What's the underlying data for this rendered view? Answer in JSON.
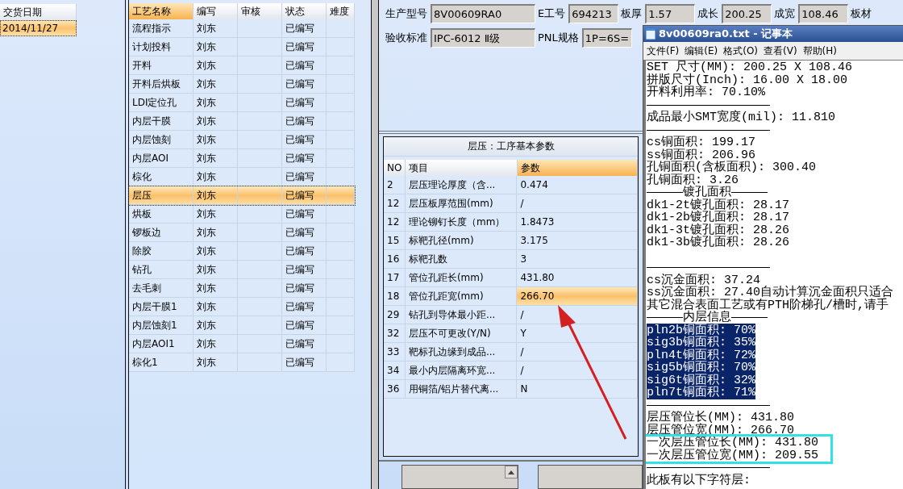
{
  "delivery_table": {
    "columns": [
      {
        "label": "交货日期",
        "selected": false
      }
    ],
    "rows": [
      {
        "date": "2014/11/27",
        "selected": true
      }
    ]
  },
  "process_table": {
    "columns": [
      {
        "label": "工艺名称",
        "selected": true
      },
      {
        "label": "编写",
        "selected": false
      },
      {
        "label": "审核",
        "selected": false
      },
      {
        "label": "状态",
        "selected": false
      },
      {
        "label": "难度",
        "selected": false
      }
    ],
    "rows": [
      {
        "name": "流程指示",
        "author": "刘东",
        "status": "已编写",
        "selected": false
      },
      {
        "name": "计划投料",
        "author": "刘东",
        "status": "已编写",
        "selected": false
      },
      {
        "name": "开料",
        "author": "刘东",
        "status": "已编写",
        "selected": false
      },
      {
        "name": "开料后烘板",
        "author": "刘东",
        "status": "已编写",
        "selected": false
      },
      {
        "name": "LDI定位孔",
        "author": "刘东",
        "status": "已编写",
        "selected": false
      },
      {
        "name": "内层干膜",
        "author": "刘东",
        "status": "已编写",
        "selected": false
      },
      {
        "name": "内层蚀刻",
        "author": "刘东",
        "status": "已编写",
        "selected": false
      },
      {
        "name": "内层AOI",
        "author": "刘东",
        "status": "已编写",
        "selected": false
      },
      {
        "name": "棕化",
        "author": "刘东",
        "status": "已编写",
        "selected": false
      },
      {
        "name": "层压",
        "author": "刘东",
        "status": "已编写",
        "selected": true
      },
      {
        "name": "烘板",
        "author": "刘东",
        "status": "已编写",
        "selected": false
      },
      {
        "name": "锣板边",
        "author": "刘东",
        "status": "已编写",
        "selected": false
      },
      {
        "name": "除胶",
        "author": "刘东",
        "status": "已编写",
        "selected": false
      },
      {
        "name": "钻孔",
        "author": "刘东",
        "status": "已编写",
        "selected": false
      },
      {
        "name": "去毛刺",
        "author": "刘东",
        "status": "已编写",
        "selected": false
      },
      {
        "name": "内层干膜1",
        "author": "刘东",
        "status": "已编写",
        "selected": false
      },
      {
        "name": "内层蚀刻1",
        "author": "刘东",
        "status": "已编写",
        "selected": false
      },
      {
        "name": "内层AOI1",
        "author": "刘东",
        "status": "已编写",
        "selected": false
      },
      {
        "name": "棕化1",
        "author": "刘东",
        "status": "已编写",
        "selected": false
      }
    ]
  },
  "form": {
    "rows": [
      [
        {
          "label": "生产型号",
          "value": "8V00609RA0"
        },
        {
          "label": "E工号",
          "value": "694213"
        },
        {
          "label": "板厚",
          "value": "1.57"
        },
        {
          "label": "成长",
          "value": "200.25"
        },
        {
          "label": "成宽",
          "value": "108.46"
        },
        {
          "label": "板材"
        }
      ],
      [
        {
          "label": "验收标准",
          "value": "IPC-6012 Ⅱ级"
        },
        {
          "label": "PNL规格",
          "value": "1P=6S="
        }
      ]
    ]
  },
  "params_table": {
    "title": "层压：工序基本参数",
    "columns": [
      {
        "label": "NO",
        "selected": false
      },
      {
        "label": "项目",
        "selected": false
      },
      {
        "label": "参数",
        "selected": true
      }
    ],
    "rows": [
      {
        "no": "2",
        "item": "层压理论厚度（含...",
        "value": "0.474",
        "selected": false
      },
      {
        "no": "12",
        "item": "层压板厚范围(mm)",
        "value": "/",
        "selected": false
      },
      {
        "no": "12",
        "item": "理论铆钉长度（mm）",
        "value": "1.8473",
        "selected": false
      },
      {
        "no": "15",
        "item": "标靶孔径(mm)",
        "value": "3.175",
        "selected": false
      },
      {
        "no": "16",
        "item": "标靶孔数",
        "value": "3",
        "selected": false
      },
      {
        "no": "17",
        "item": "管位孔距长(mm)",
        "value": "431.80",
        "selected": false
      },
      {
        "no": "18",
        "item": "管位孔距宽(mm)",
        "value": "266.70",
        "selected": true
      },
      {
        "no": "29",
        "item": "钻孔到导体最小距...",
        "value": "/",
        "selected": false
      },
      {
        "no": "32",
        "item": "层压不可更改(Y/N)",
        "value": "Y",
        "selected": false
      },
      {
        "no": "33",
        "item": "靶标孔边缘到成品...",
        "value": "/",
        "selected": false
      },
      {
        "no": "34",
        "item": "最小内层隔离环宽...",
        "value": "/",
        "selected": false
      },
      {
        "no": "36",
        "item": "用铜箔/铝片替代离...",
        "value": "N",
        "selected": false
      }
    ]
  },
  "notepad": {
    "title": "8v00609ra0.txt - 记事本",
    "menu": [
      "文件(F)",
      "编辑(E)",
      "格式(O)",
      "查看(V)",
      "帮助(H)"
    ],
    "lines": [
      {
        "kind": "text",
        "text": "SET 尺寸(MM): 200.25 X 108.46",
        "selected": false
      },
      {
        "kind": "text",
        "text": "拼版尺寸(Inch): 16.00 X 18.00",
        "selected": false
      },
      {
        "kind": "text",
        "text": "开料利用率: 70.10%",
        "selected": false
      },
      {
        "kind": "text",
        "text": "—————————————————",
        "selected": false
      },
      {
        "kind": "text",
        "text": "成品最小SMT宽度(mil): 11.810",
        "selected": false
      },
      {
        "kind": "text",
        "text": "—————————————————",
        "selected": false
      },
      {
        "kind": "text",
        "text": "cs铜面积: 199.17",
        "selected": false
      },
      {
        "kind": "text",
        "text": "ss铜面积: 206.96",
        "selected": false
      },
      {
        "kind": "text",
        "text": "孔铜面积(含板面积): 300.40",
        "selected": false
      },
      {
        "kind": "text",
        "text": "孔铜面积: 3.26",
        "selected": false
      },
      {
        "kind": "text",
        "text": "—————镀孔面积—————",
        "selected": false
      },
      {
        "kind": "text",
        "text": "dk1-2t镀孔面积: 28.17",
        "selected": false
      },
      {
        "kind": "text",
        "text": "dk1-2b镀孔面积: 28.17",
        "selected": false
      },
      {
        "kind": "text",
        "text": "dk1-3t镀孔面积: 28.26",
        "selected": false
      },
      {
        "kind": "text",
        "text": "dk1-3b镀孔面积: 28.26",
        "selected": false
      },
      {
        "kind": "blank",
        "selected": false
      },
      {
        "kind": "text",
        "text": "—————————————————",
        "selected": false
      },
      {
        "kind": "text",
        "text": "cs沉金面积: 37.24",
        "selected": false
      },
      {
        "kind": "text",
        "text": "ss沉金面积: 27.40自动计算沉金面积只适合",
        "selected": false
      },
      {
        "kind": "text",
        "text": "其它混合表面工艺或有PTH阶梯孔/槽时,请手",
        "selected": false
      },
      {
        "kind": "text",
        "text": "—————内层信息—————",
        "selected": false
      },
      {
        "kind": "text",
        "text": "pln2b铜面积: 70%",
        "selected": true
      },
      {
        "kind": "text",
        "text": "sig3b铜面积: 35%",
        "selected": true
      },
      {
        "kind": "text",
        "text": "pln4t铜面积: 72%",
        "selected": true
      },
      {
        "kind": "text",
        "text": "sig5b铜面积: 70%",
        "selected": true
      },
      {
        "kind": "text",
        "text": "sig6t铜面积: 32%",
        "selected": true
      },
      {
        "kind": "text",
        "text": "pln7t铜面积: 71%",
        "selected": true
      },
      {
        "kind": "text",
        "text": "—————————————————",
        "selected": false
      },
      {
        "kind": "text",
        "text": "层压管位长(MM): 431.80",
        "selected": false
      },
      {
        "kind": "text",
        "text": "层压管位宽(MM): 266.70",
        "selected": false
      },
      {
        "kind": "boxed",
        "text": "一次层压管位长(MM): 431.80",
        "selected": false
      },
      {
        "kind": "boxed",
        "text": "一次层压管位宽(MM): 209.55",
        "selected": false
      },
      {
        "kind": "text",
        "text": "—————————————————",
        "selected": false
      },
      {
        "kind": "text",
        "text": "此板有以下字符层:",
        "selected": false
      }
    ]
  }
}
